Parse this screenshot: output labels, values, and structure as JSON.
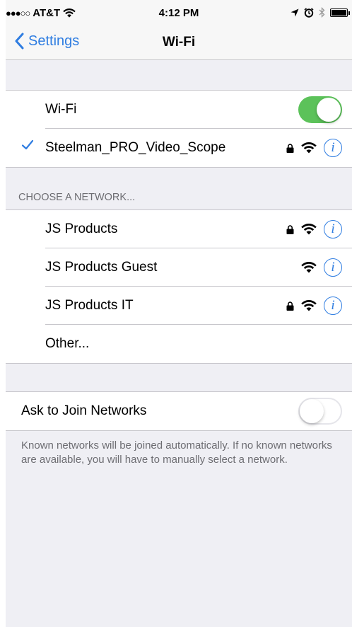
{
  "status_bar": {
    "signal_dots": "●●●○○",
    "carrier": "AT&T",
    "time": "4:12 PM",
    "icons": [
      "wifi-icon",
      "location-icon",
      "alarm-icon",
      "bluetooth-icon",
      "battery-icon"
    ]
  },
  "nav": {
    "back_label": "Settings",
    "title": "Wi-Fi"
  },
  "wifi": {
    "label": "Wi-Fi",
    "enabled": true,
    "connected_network": "Steelman_PRO_Video_Scope"
  },
  "networks": {
    "header": "CHOOSE A NETWORK...",
    "items": [
      {
        "name": "JS Products",
        "secured": true
      },
      {
        "name": "JS Products Guest",
        "secured": false
      },
      {
        "name": "JS Products IT",
        "secured": true
      }
    ],
    "other_label": "Other..."
  },
  "ask_to_join": {
    "label": "Ask to Join Networks",
    "enabled": false,
    "footer": "Known networks will be joined automatically. If no known networks are available, you will have to manually select a network."
  },
  "colors": {
    "accent": "#2f7de1",
    "toggle_on": "#5cc25a",
    "background": "#efeff4"
  }
}
